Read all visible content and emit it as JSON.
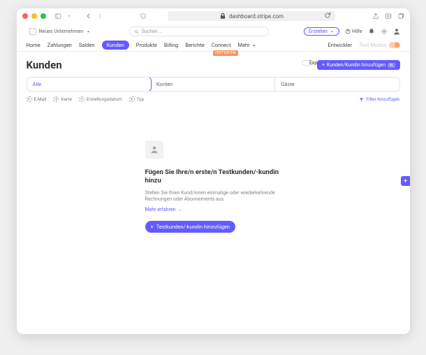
{
  "browser": {
    "url": "dashboard.stripe.com"
  },
  "header": {
    "org_label": "Neues Unternehmen",
    "search_placeholder": "Suchen …",
    "create_label": "Erstellen",
    "help_label": "Hilfe"
  },
  "nav": {
    "items": [
      "Home",
      "Zahlungen",
      "Salden",
      "Kunden",
      "Produkte",
      "Billing",
      "Berichte",
      "Connect",
      "Mehr"
    ],
    "active": "Kunden",
    "connect_badge": "TESTDATEN",
    "right": {
      "developers": "Entwickler",
      "test_mode": "Test-Modus"
    }
  },
  "page": {
    "title": "Kunden",
    "actions": {
      "export": "Exportieren",
      "add_customer": "Kunden/Kundin hinzufügen",
      "shortcut": "N"
    },
    "segments": [
      "Alle",
      "Konten",
      "Gäste"
    ],
    "segment_active": "Alle",
    "filters": {
      "items": [
        "E-Mail",
        "Karte",
        "Erstellungsdatum",
        "Typ"
      ],
      "add": "Filter hinzufügen"
    },
    "empty": {
      "title": "Fügen Sie Ihre/n erste/n Testkunden/-kundin hinzu",
      "desc": "Stellen Sie Ihren Kund/innen einmalige oder wiederkehrende Rechnungen oder Abonnements aus.",
      "learn_more": "Mehr erfahren",
      "add_test": "Testkunden/-kundin hinzufügen"
    }
  }
}
